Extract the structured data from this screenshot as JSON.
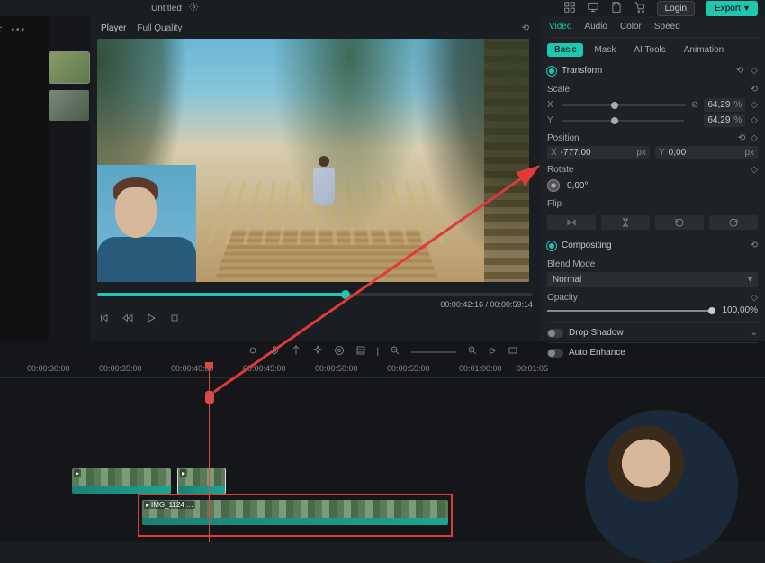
{
  "topbar": {
    "title": "Untitled",
    "login": "Login",
    "export": "Export"
  },
  "preview": {
    "player_label": "Player",
    "quality": "Full Quality",
    "timecode": "00:00:42:16  /  00:00:59:14"
  },
  "panel": {
    "tabs1": {
      "video": "Video",
      "audio": "Audio",
      "color": "Color",
      "speed": "Speed"
    },
    "tabs2": {
      "basic": "Basic",
      "mask": "Mask",
      "aitools": "AI Tools",
      "animation": "Animation"
    },
    "transform": "Transform",
    "scale": {
      "label": "Scale",
      "x": "64,29",
      "y": "64,29",
      "unit": "%"
    },
    "position": {
      "label": "Position",
      "x": "-777,00",
      "y": "0,00",
      "unit": "px"
    },
    "rotate": {
      "label": "Rotate",
      "value": "0,00°"
    },
    "flip": "Flip",
    "compositing": "Compositing",
    "blendmode": {
      "label": "Blend Mode",
      "value": "Normal"
    },
    "opacity": {
      "label": "Opacity",
      "value": "100,00",
      "unit": "%"
    },
    "dropshadow": "Drop Shadow",
    "autoenhance": "Auto Enhance"
  },
  "timeline": {
    "ticks": [
      "00:00:30:00",
      "00:00:35:00",
      "00:00:40:00",
      "00:00:45:00",
      "00:00:50:00",
      "00:00:55:00",
      "00:01:00:00",
      "00:01:05"
    ],
    "clip3_label": "IMG_1124 …"
  }
}
